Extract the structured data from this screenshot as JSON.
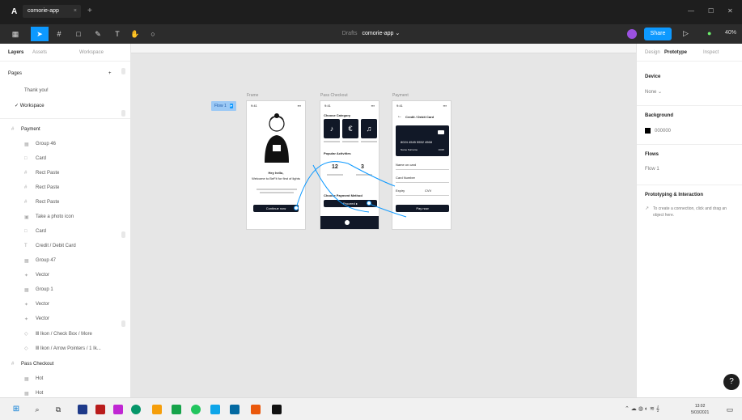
{
  "titlebar": {
    "tab_title": "comorie-app",
    "tab_close": "×",
    "new_tab": "+",
    "minimize": "—",
    "maximize": "☐",
    "close": "✕"
  },
  "toolbar": {
    "doc_owner": "Drafts",
    "doc_name": "comorie-app ⌄",
    "share_label": "Share",
    "play_icon": "▷",
    "zoom": "40%"
  },
  "left_panel": {
    "tabs": [
      "Layers",
      "Assets",
      "Workspace"
    ],
    "pages_header": "Pages",
    "pages_add": "+",
    "pages": [
      "Thank you!",
      "✓ Workspace"
    ],
    "frame_name": "Payment",
    "layers": [
      "Group 46",
      "Card",
      "Rect Paste",
      "Rect Paste",
      "Rect Paste",
      "Take a photo icon",
      "Card",
      "Credit / Debit Card",
      "Group 47",
      "Vector",
      "Group 1",
      "Vector",
      "Vector",
      "Ⅲ Ikon / Check Box / More",
      "Ⅲ Ikon / Arrow Pointers / 1 Ik..."
    ],
    "frame2_name": "Pass Checkout",
    "frame2_layers": [
      "Hot",
      "Hot"
    ]
  },
  "canvas": {
    "flow_badge": "Flow 1",
    "flow_badge_end": "▸",
    "frame_labels": [
      "Frame",
      "Pass Checkout",
      "Payment"
    ],
    "frame1": {
      "title": "Hey hello,",
      "subtitle": "Welcome to BeFit for first of lights",
      "button": "Continue now"
    },
    "frame2": {
      "heading": "Choose Category",
      "section": "Popular Activities",
      "stat1": "12",
      "stat2": "3",
      "section2": "Choose Payment Method",
      "cta": "Proceed ▸"
    },
    "frame3": {
      "heading": "Credit / Debit Card",
      "card_number": "8024 4545 5552 4568",
      "card_holder": "Name Surname",
      "card_exp": "10/25",
      "fields": [
        "Name on card",
        "Card Number",
        "Expiry",
        "CVV"
      ],
      "pay_button": "Pay now"
    },
    "status_time": "9:41",
    "status_icons": "▪▪▪"
  },
  "right_panel": {
    "tabs": [
      "Design",
      "Prototype",
      "Inspect"
    ],
    "device_header": "Device",
    "device_value": "None ⌄",
    "background_header": "Background",
    "background_hex": "000000",
    "flows_header": "Flows",
    "flows_value": "Flow 1",
    "interaction_header": "Prototyping & Interaction",
    "interaction_icon": "↗",
    "interaction_hint": "To create a connection, click and drag an object here.",
    "help": "?"
  },
  "taskbar": {
    "clock_time": "13:02",
    "clock_date": "5/03/2021",
    "tray": "⌃ ☁ ◍ ◐ ≋ 𝄞"
  },
  "colors": {
    "accent": "#0d99ff",
    "dark": "#111827",
    "canvas": "#e6e6e6"
  }
}
